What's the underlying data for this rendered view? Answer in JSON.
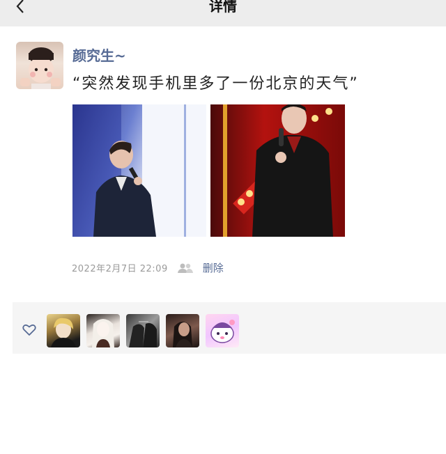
{
  "header": {
    "title": "详情",
    "back_icon": "chevron-left-icon"
  },
  "post": {
    "username": "颜究生~",
    "text": "“突然发现手机里多了一份北京的天气”",
    "datetime": "2022年2月7日 22:09",
    "delete_label": "删除"
  },
  "likes": {
    "icon": "heart-outline-icon",
    "accent_color": "#576b95"
  }
}
